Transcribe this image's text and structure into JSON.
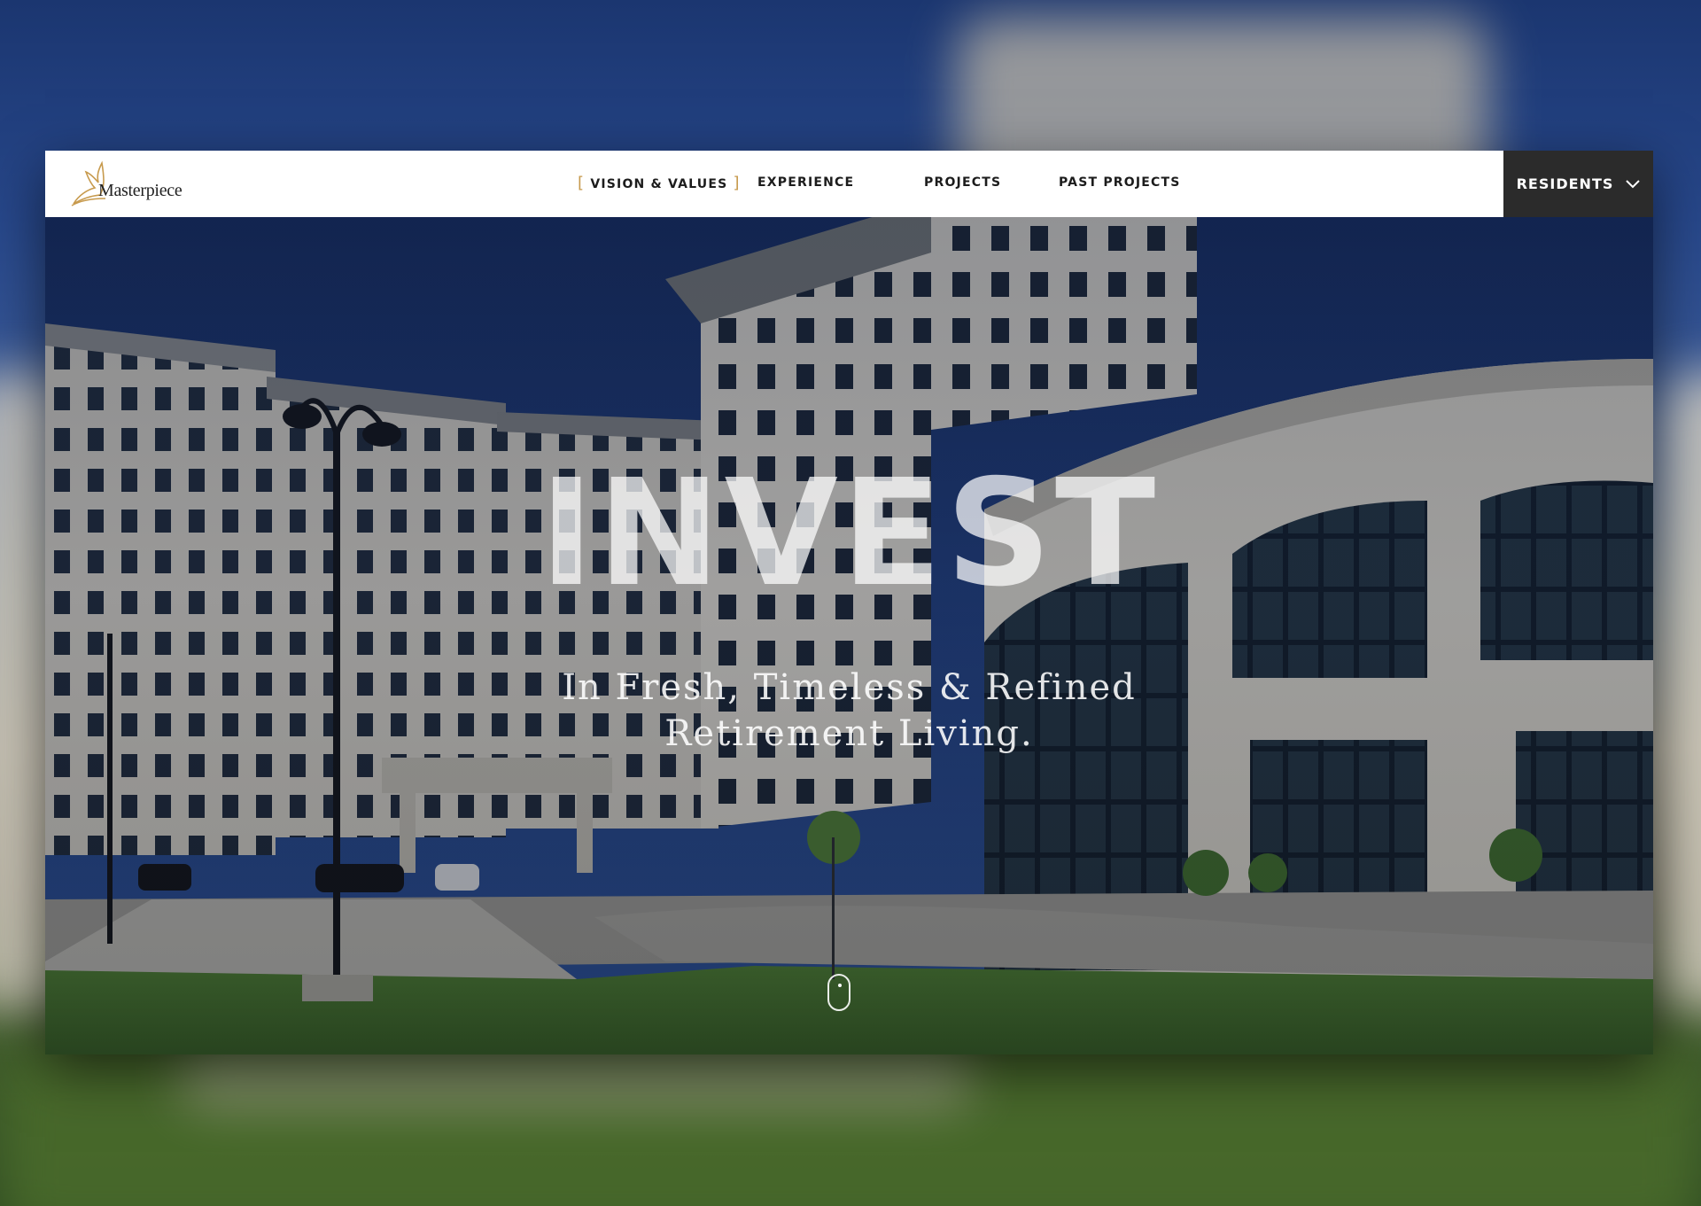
{
  "brand": {
    "name": "Masterpiece",
    "accent_color": "#c79a4d",
    "logo_icon": "bird-logo-icon"
  },
  "nav": {
    "items": [
      {
        "label": "VISION & VALUES",
        "active": true,
        "bracket_open": "[",
        "bracket_close": "]"
      },
      {
        "label": "EXPERIENCE",
        "active": false
      },
      {
        "label": "PROJECTS",
        "active": false
      },
      {
        "label": "PAST PROJECTS",
        "active": false
      }
    ],
    "residents": {
      "label": "RESIDENTS",
      "icon": "chevron-down-icon",
      "background": "#2b2b2b"
    }
  },
  "hero": {
    "title": "INVEST",
    "subtitle_line1": "In Fresh, Timeless & Refined",
    "subtitle_line2": "Retirement Living.",
    "scroll_icon": "mouse-scroll-icon"
  }
}
